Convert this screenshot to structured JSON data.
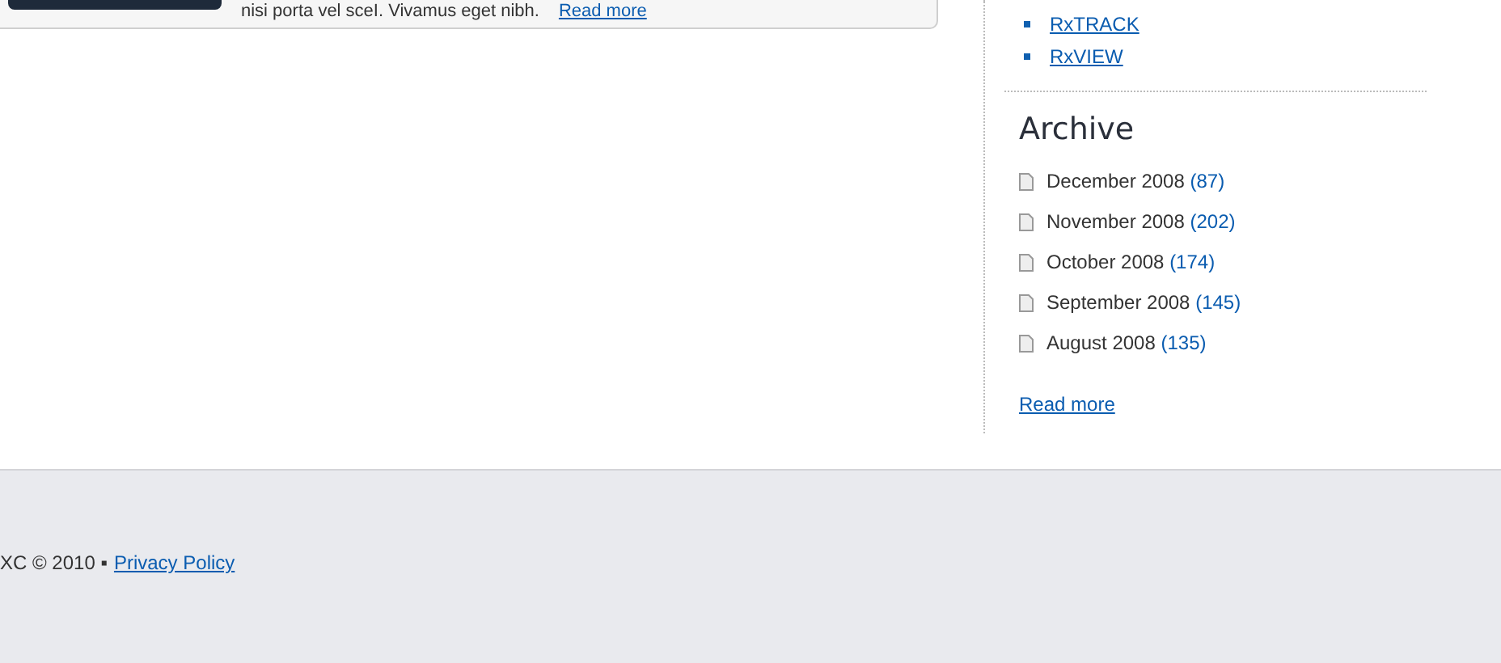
{
  "article_card": {
    "excerpt": "nisi porta vel sceI. Vivamus eget nibh.",
    "read_more": "Read more"
  },
  "sidebar": {
    "products": [
      "RxTRACK",
      "RxVIEW"
    ],
    "archive": {
      "title": "Archive",
      "items": [
        {
          "label": "December 2008",
          "count": "(87)"
        },
        {
          "label": "November 2008",
          "count": "(202)"
        },
        {
          "label": "October 2008",
          "count": "(174)"
        },
        {
          "label": "September 2008",
          "count": "(145)"
        },
        {
          "label": "August 2008",
          "count": "(135)"
        }
      ],
      "read_more": "Read more"
    }
  },
  "footer": {
    "copyright": "XC © 2010 ▪",
    "link": "Privacy Policy"
  }
}
